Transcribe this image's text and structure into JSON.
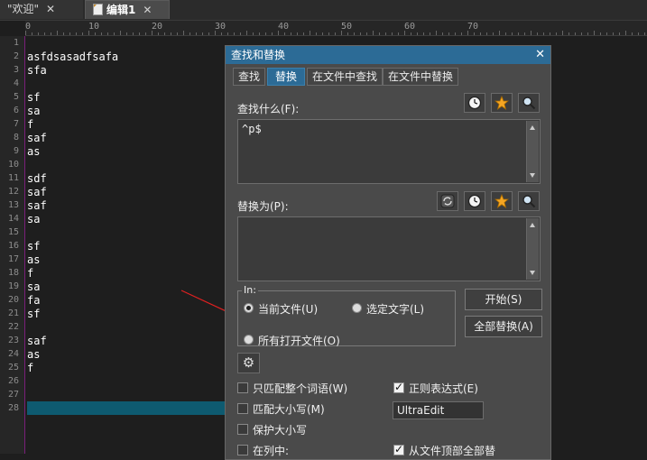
{
  "tabs": [
    {
      "label": "\"欢迎\"",
      "close": "✕"
    },
    {
      "label": "编辑1",
      "close": "✕"
    }
  ],
  "ruler": {
    "ticks": [
      "0",
      "10",
      "20",
      "30",
      "40",
      "50",
      "60",
      "70"
    ]
  },
  "gutter": {
    "lines": [
      "1",
      "2",
      "3",
      "4",
      "5",
      "6",
      "7",
      "8",
      "9",
      "10",
      "11",
      "12",
      "13",
      "14",
      "15",
      "16",
      "17",
      "18",
      "19",
      "20",
      "21",
      "22",
      "23",
      "24",
      "25",
      "26",
      "27",
      "28"
    ]
  },
  "editor": {
    "lines": [
      "",
      "asfdsasadfsafa",
      "sfa",
      "",
      "sf",
      "sa",
      "f",
      "saf",
      "as",
      "",
      "sdf",
      "saf",
      "saf",
      "sa",
      "",
      "sf",
      "as",
      "f",
      "sa",
      "fa",
      "sf",
      "",
      "saf",
      "as",
      "f",
      "",
      "",
      ""
    ]
  },
  "dialog": {
    "title": "查找和替换",
    "close": "✕",
    "tabs": [
      "查找",
      "替换",
      "在文件中查找",
      "在文件中替换"
    ],
    "find_label": "查找什么(F):",
    "find_value": "^p$",
    "replace_label": "替换为(P):",
    "replace_value": "",
    "in_label": "In:",
    "scope_current": "当前文件(U)",
    "scope_selection": "选定文字(L)",
    "scope_all_open": "所有打开文件(O)",
    "start_button": "开始(S)",
    "replace_all_button": "全部替换(A)",
    "opt_whole_word": "只匹配整个词语(W)",
    "opt_match_case": "匹配大小写(M)",
    "opt_preserve_case": "保护大小写",
    "opt_in_column": "在列中:",
    "opt_regex": "正则表达式(E)",
    "regex_engine": "UltraEdit",
    "opt_from_top": "从文件顶部全部替"
  },
  "colors": {
    "accent": "#2c6b96",
    "arrow": "#e02020",
    "gutter_border": "#7a1f7a"
  }
}
